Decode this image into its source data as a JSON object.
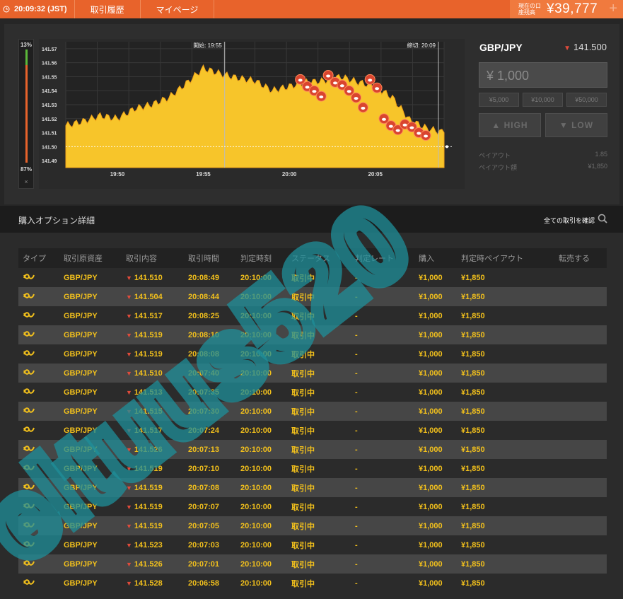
{
  "topbar": {
    "time": "20:09:32 (JST)",
    "nav": [
      "取引履歴",
      "マイページ"
    ],
    "balance_label": "現在の口座残高",
    "balance": "¥39,777",
    "plus": "+"
  },
  "gauge": {
    "high_pct": "13%",
    "low_pct": "87%",
    "close": "×"
  },
  "chart_meta": {
    "start_label": "開始: 19:55",
    "end_label": "締切: 20:09",
    "y_ticks": [
      "141.57",
      "141.56",
      "141.55",
      "141.54",
      "141.53",
      "141.52",
      "141.51",
      "141.50",
      "141.49"
    ],
    "x_ticks": [
      "19:50",
      "19:55",
      "20:00",
      "20:05"
    ]
  },
  "chart_data": {
    "type": "area",
    "title": "",
    "xlabel": "",
    "ylabel": "",
    "ylim": [
      141.485,
      141.575
    ],
    "x": [
      "19:47",
      "19:48",
      "19:49",
      "19:50",
      "19:51",
      "19:52",
      "19:53",
      "19:54",
      "19:55",
      "19:56",
      "19:57",
      "19:58",
      "19:59",
      "20:00",
      "20:01",
      "20:02",
      "20:03",
      "20:04",
      "20:05",
      "20:06",
      "20:07",
      "20:08",
      "20:09"
    ],
    "series": [
      {
        "values": [
          141.515,
          141.518,
          141.522,
          141.52,
          141.527,
          141.53,
          141.535,
          141.545,
          141.556,
          141.552,
          141.549,
          141.547,
          141.54,
          141.543,
          141.546,
          141.547,
          141.55,
          141.546,
          141.543,
          141.535,
          141.519,
          141.513,
          141.51
        ]
      }
    ],
    "entry_points": [
      141.548,
      141.543,
      141.54,
      141.536,
      141.551,
      141.546,
      141.544,
      141.54,
      141.535,
      141.528,
      141.548,
      141.542,
      141.52,
      141.515,
      141.512,
      141.516,
      141.514,
      141.51,
      141.508
    ]
  },
  "side": {
    "pair": "GBP/JPY",
    "rate": "141.500",
    "amount": "¥ 1,000",
    "quick": [
      "¥5,000",
      "¥10,000",
      "¥50,000"
    ],
    "high": "▲ HIGH",
    "low": "▼ LOW",
    "payout_label": "ペイアウト",
    "payout_value": "1.85",
    "payout_amount_label": "ペイアウト額",
    "payout_amount_value": "¥1,850"
  },
  "detail": {
    "title": "購入オプション詳細",
    "all_trades": "全ての取引を確認"
  },
  "table": {
    "headers": [
      "タイプ",
      "取引原資産",
      "取引内容",
      "取引時間",
      "判定時刻",
      "ステータス",
      "判定レート",
      "購入",
      "判定時ペイアウト",
      "転売する"
    ],
    "rows": [
      {
        "asset": "GBP/JPY",
        "rate": "141.510",
        "time": "20:08:49",
        "judge": "20:10:00",
        "status": "取引中",
        "jrate": "-",
        "buy": "¥1,000",
        "payout": "¥1,850"
      },
      {
        "asset": "GBP/JPY",
        "rate": "141.504",
        "time": "20:08:44",
        "judge": "20:10:00",
        "status": "取引中",
        "jrate": "-",
        "buy": "¥1,000",
        "payout": "¥1,850"
      },
      {
        "asset": "GBP/JPY",
        "rate": "141.517",
        "time": "20:08:25",
        "judge": "20:10:00",
        "status": "取引中",
        "jrate": "-",
        "buy": "¥1,000",
        "payout": "¥1,850"
      },
      {
        "asset": "GBP/JPY",
        "rate": "141.519",
        "time": "20:08:10",
        "judge": "20:10:00",
        "status": "取引中",
        "jrate": "-",
        "buy": "¥1,000",
        "payout": "¥1,850"
      },
      {
        "asset": "GBP/JPY",
        "rate": "141.519",
        "time": "20:08:08",
        "judge": "20:10:00",
        "status": "取引中",
        "jrate": "-",
        "buy": "¥1,000",
        "payout": "¥1,850"
      },
      {
        "asset": "GBP/JPY",
        "rate": "141.510",
        "time": "20:07:40",
        "judge": "20:10:00",
        "status": "取引中",
        "jrate": "-",
        "buy": "¥1,000",
        "payout": "¥1,850"
      },
      {
        "asset": "GBP/JPY",
        "rate": "141.513",
        "time": "20:07:35",
        "judge": "20:10:00",
        "status": "取引中",
        "jrate": "-",
        "buy": "¥1,000",
        "payout": "¥1,850"
      },
      {
        "asset": "GBP/JPY",
        "rate": "141.515",
        "time": "20:07:30",
        "judge": "20:10:00",
        "status": "取引中",
        "jrate": "-",
        "buy": "¥1,000",
        "payout": "¥1,850"
      },
      {
        "asset": "GBP/JPY",
        "rate": "141.517",
        "time": "20:07:24",
        "judge": "20:10:00",
        "status": "取引中",
        "jrate": "-",
        "buy": "¥1,000",
        "payout": "¥1,850"
      },
      {
        "asset": "GBP/JPY",
        "rate": "141.526",
        "time": "20:07:13",
        "judge": "20:10:00",
        "status": "取引中",
        "jrate": "-",
        "buy": "¥1,000",
        "payout": "¥1,850"
      },
      {
        "asset": "GBP/JPY",
        "rate": "141.519",
        "time": "20:07:10",
        "judge": "20:10:00",
        "status": "取引中",
        "jrate": "-",
        "buy": "¥1,000",
        "payout": "¥1,850"
      },
      {
        "asset": "GBP/JPY",
        "rate": "141.519",
        "time": "20:07:08",
        "judge": "20:10:00",
        "status": "取引中",
        "jrate": "-",
        "buy": "¥1,000",
        "payout": "¥1,850"
      },
      {
        "asset": "GBP/JPY",
        "rate": "141.519",
        "time": "20:07:07",
        "judge": "20:10:00",
        "status": "取引中",
        "jrate": "-",
        "buy": "¥1,000",
        "payout": "¥1,850"
      },
      {
        "asset": "GBP/JPY",
        "rate": "141.519",
        "time": "20:07:05",
        "judge": "20:10:00",
        "status": "取引中",
        "jrate": "-",
        "buy": "¥1,000",
        "payout": "¥1,850"
      },
      {
        "asset": "GBP/JPY",
        "rate": "141.523",
        "time": "20:07:03",
        "judge": "20:10:00",
        "status": "取引中",
        "jrate": "-",
        "buy": "¥1,000",
        "payout": "¥1,850"
      },
      {
        "asset": "GBP/JPY",
        "rate": "141.526",
        "time": "20:07:01",
        "judge": "20:10:00",
        "status": "取引中",
        "jrate": "-",
        "buy": "¥1,000",
        "payout": "¥1,850"
      },
      {
        "asset": "GBP/JPY",
        "rate": "141.528",
        "time": "20:06:58",
        "judge": "20:10:00",
        "status": "取引中",
        "jrate": "-",
        "buy": "¥1,000",
        "payout": "¥1,850"
      }
    ]
  },
  "watermark": "eltuus520",
  "colors": {
    "accent": "#e8632b",
    "gold": "#f2c01c",
    "area_fill": "#f7c52a",
    "down_red": "#e04b3b",
    "watermark": "#1f8f9a"
  }
}
